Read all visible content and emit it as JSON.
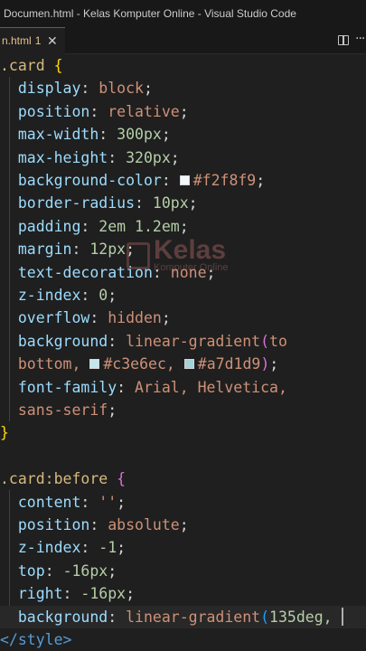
{
  "window": {
    "title": "Documen.html - Kelas Komputer Online - Visual Studio Code"
  },
  "tab": {
    "name": "n.html",
    "problem_count": "1",
    "close_glyph": "✕",
    "split_icon": "split-editor-icon",
    "more_icon": "more-actions-icon"
  },
  "watermark": {
    "logo_icon": "kelas-komputer-logo",
    "title": "Kelas",
    "subtitle": "Komputer Online"
  },
  "colors": {
    "swatch_1": "#f2f8f9",
    "swatch_2": "#c3e6ec",
    "swatch_3": "#a7d1d9",
    "accent": "#0078d4"
  },
  "code": {
    "l1_sel": ".card",
    "l1_brace": "{",
    "l2_prop": "display",
    "l2_val": "block",
    "l3_prop": "position",
    "l3_val": "relative",
    "l4_prop": "max-width",
    "l4_num": "300",
    "l4_unit": "px",
    "l5_prop": "max-height",
    "l5_num": "320",
    "l5_unit": "px",
    "l6_prop": "background-color",
    "l6_val": "#f2f8f9",
    "l7_prop": "border-radius",
    "l7_num": "10",
    "l7_unit": "px",
    "l8_prop": "padding",
    "l8_num1": "2",
    "l8_unit1": "em",
    "l8_num2": "1.2",
    "l8_unit2": "em",
    "l9_prop": "margin",
    "l9_num": "12",
    "l9_unit": "px",
    "l10_prop": "text-decoration",
    "l10_val": "none",
    "l11_prop": "z-index",
    "l11_num": "0",
    "l12_prop": "overflow",
    "l12_val": "hidden",
    "l13_prop": "background",
    "l13_fn": "linear-gradient",
    "l13_paren": "(",
    "l13_val": "to",
    "l14_val": "bottom,",
    "l14_c1": "#c3e6ec,",
    "l14_c2": "#a7d1d9",
    "l14_paren": ")",
    "l15_prop": "font-family",
    "l15_val": "Arial, Helvetica,",
    "l16_val": "sans-serif",
    "l17_brace": "}",
    "l19_sel": ".card",
    "l19_pseudo": ":before",
    "l19_brace": "{",
    "l20_prop": "content",
    "l20_val": "''",
    "l21_prop": "position",
    "l21_val": "absolute",
    "l22_prop": "z-index",
    "l22_num": "-1",
    "l23_prop": "top",
    "l23_num": "-16",
    "l23_unit": "px",
    "l24_prop": "right",
    "l24_num": "-16",
    "l24_unit": "px",
    "l25_prop": "background",
    "l25_fn": "linear-gradient",
    "l25_paren": "(",
    "l25_num": "135",
    "l25_unit": "deg,",
    "l26_tag": "</style>"
  }
}
